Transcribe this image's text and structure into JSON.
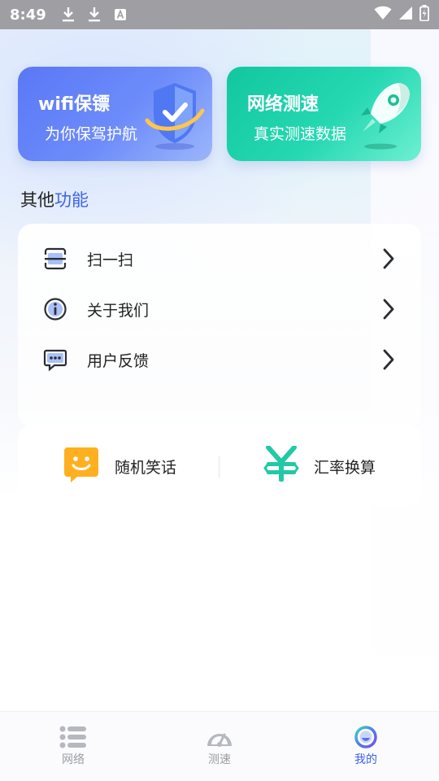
{
  "status_bar": {
    "time": "8:49"
  },
  "cards": {
    "wifi": {
      "title": "wifi保镖",
      "subtitle": "为你保驾护航"
    },
    "speed": {
      "title": "网络测速",
      "subtitle": "真实测速数据"
    }
  },
  "section": {
    "title_plain": "其他",
    "title_accent": "功能"
  },
  "menu": [
    {
      "label": "扫一扫",
      "icon": "scan-icon"
    },
    {
      "label": "关于我们",
      "icon": "info-icon"
    },
    {
      "label": "用户反馈",
      "icon": "feedback-icon"
    }
  ],
  "tools": {
    "joke": {
      "label": "随机笑话",
      "icon": "smile-icon"
    },
    "rate": {
      "label": "汇率换算",
      "icon": "yen-icon"
    }
  },
  "bottom_nav": [
    {
      "label": "网络",
      "icon": "list-icon"
    },
    {
      "label": "测速",
      "icon": "speedometer-icon"
    },
    {
      "label": "我的",
      "icon": "profile-icon",
      "active": true
    }
  ],
  "colors": {
    "accent": "#3d63e8",
    "wifi_card": "#5a78f6",
    "speed_card": "#12c7a0",
    "joke_icon": "#ffb020",
    "rate_icon": "#22c9a6"
  }
}
